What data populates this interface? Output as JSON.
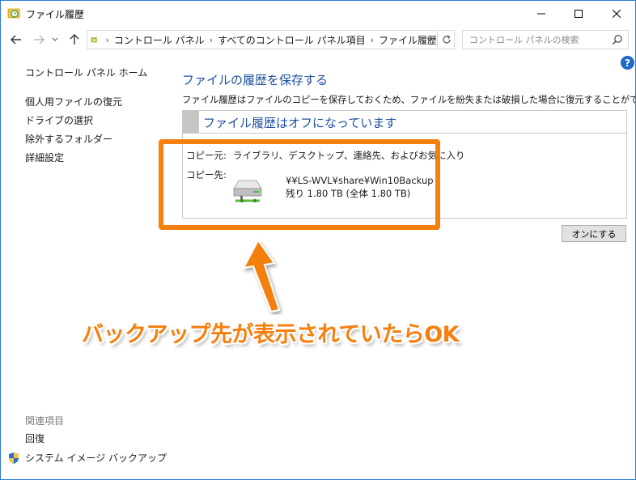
{
  "window": {
    "title": "ファイル履歴"
  },
  "address": {
    "breadcrumbs": [
      "コントロール パネル",
      "すべてのコントロール パネル項目",
      "ファイル履歴"
    ],
    "search_placeholder": "コントロール パネルの検索"
  },
  "sidebar": {
    "home": "コントロール パネル ホーム",
    "links": [
      "個人用ファイルの復元",
      "ドライブの選択",
      "除外するフォルダー",
      "詳細設定"
    ],
    "related_heading": "関連項目",
    "related_link": "回復",
    "system_image": "システム イメージ バックアップ"
  },
  "main": {
    "title": "ファイルの履歴を保存する",
    "description": "ファイル履歴はファイルのコピーを保存しておくため、ファイルを紛失または破損した場合に復元することができます。",
    "status": "ファイル履歴はオフになっています",
    "source_label": "コピー元:",
    "source_value": "ライブラリ、デスクトップ、連絡先、およびお気に入り",
    "dest_label": "コピー先:",
    "dest_path": "¥¥LS-WVL¥share¥Win10Backup",
    "dest_space": "残り 1.80 TB (全体 1.80 TB)",
    "turn_on_button": "オンにする"
  },
  "annotation": {
    "caption": "バックアップ先が表示されていたらOK",
    "color": "#f57f0f"
  },
  "icons": {
    "title": "file-history-icon",
    "drive": "network-drive-icon",
    "shield": "uac-shield-icon"
  }
}
